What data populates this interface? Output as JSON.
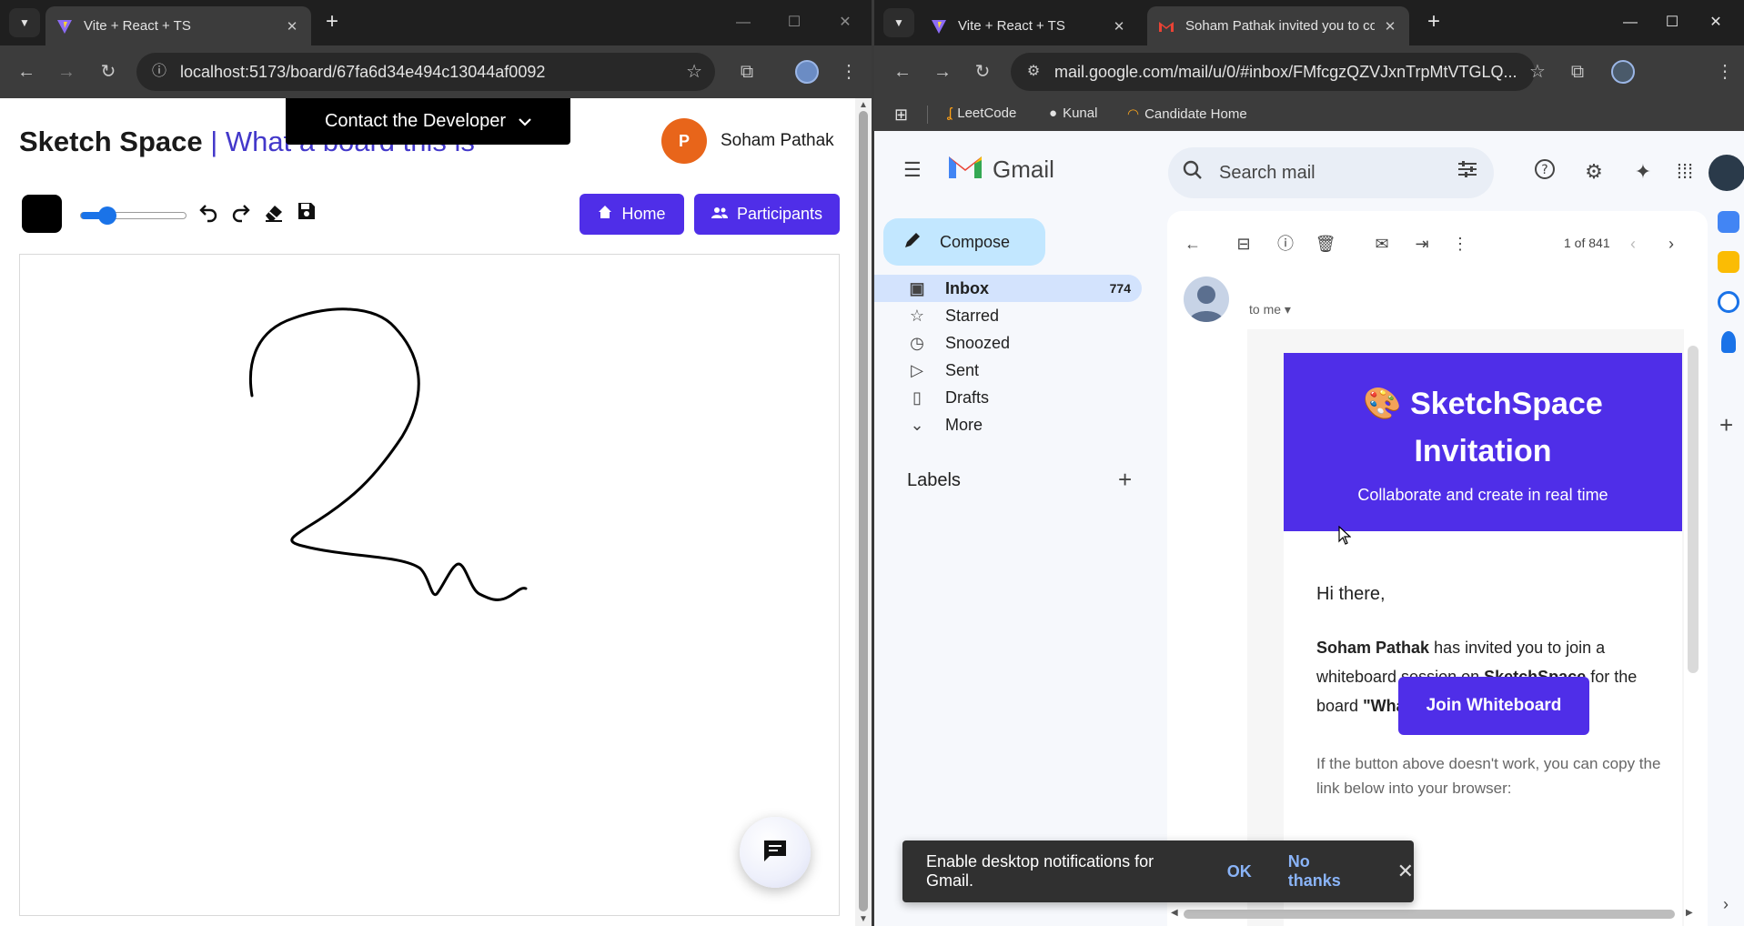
{
  "left_browser": {
    "tab_title": "Vite + React + TS",
    "url": "localhost:5173/board/67fa6d34e494c13044af0092"
  },
  "sketch_app": {
    "brand": "Sketch Space",
    "separator": "|",
    "board_name": "What a board this is",
    "contact_label": "Contact the Developer",
    "user_initial": "P",
    "user_name": "Soham Pathak",
    "home_label": "Home",
    "participants_label": "Participants",
    "brush_color": "#000000",
    "brush_size_fraction": 0.25,
    "accent": "#4f2ee8"
  },
  "right_browser": {
    "tab1_title": "Vite + React + TS",
    "tab2_title": "Soham Pathak invited you to co",
    "url": "mail.google.com/mail/u/0/#inbox/FMfcgzQZVJxnTrpMtVTGLQ...",
    "bookmarks": [
      "LeetCode",
      "Kunal",
      "Candidate Home"
    ]
  },
  "gmail": {
    "logo_text": "Gmail",
    "search_placeholder": "Search mail",
    "compose_label": "Compose",
    "nav": [
      {
        "label": "Inbox",
        "count": "774"
      },
      {
        "label": "Starred",
        "count": ""
      },
      {
        "label": "Snoozed",
        "count": ""
      },
      {
        "label": "Sent",
        "count": ""
      },
      {
        "label": "Drafts",
        "count": ""
      },
      {
        "label": "More",
        "count": ""
      }
    ],
    "labels_heading": "Labels",
    "pager": "1 of 841",
    "to_me": "to me",
    "email": {
      "hero_title_line1": "SketchSpace",
      "hero_title_line2": "Invitation",
      "hero_subtitle": "Collaborate and create in real time",
      "greeting": "Hi there,",
      "inviter": "Soham Pathak",
      "text1": "has invited you to join a whiteboard session on",
      "app_name": "SketchSpace",
      "text2": "for the board",
      "board_quoted": "\"What a board this is \"",
      "text3": ".",
      "join_label": "Join Whiteboard",
      "fallback_text": "If the button above doesn't work, you can copy the link below into your browser:"
    },
    "toast": {
      "message": "Enable desktop notifications for Gmail.",
      "ok": "OK",
      "no_thanks": "No thanks"
    }
  }
}
